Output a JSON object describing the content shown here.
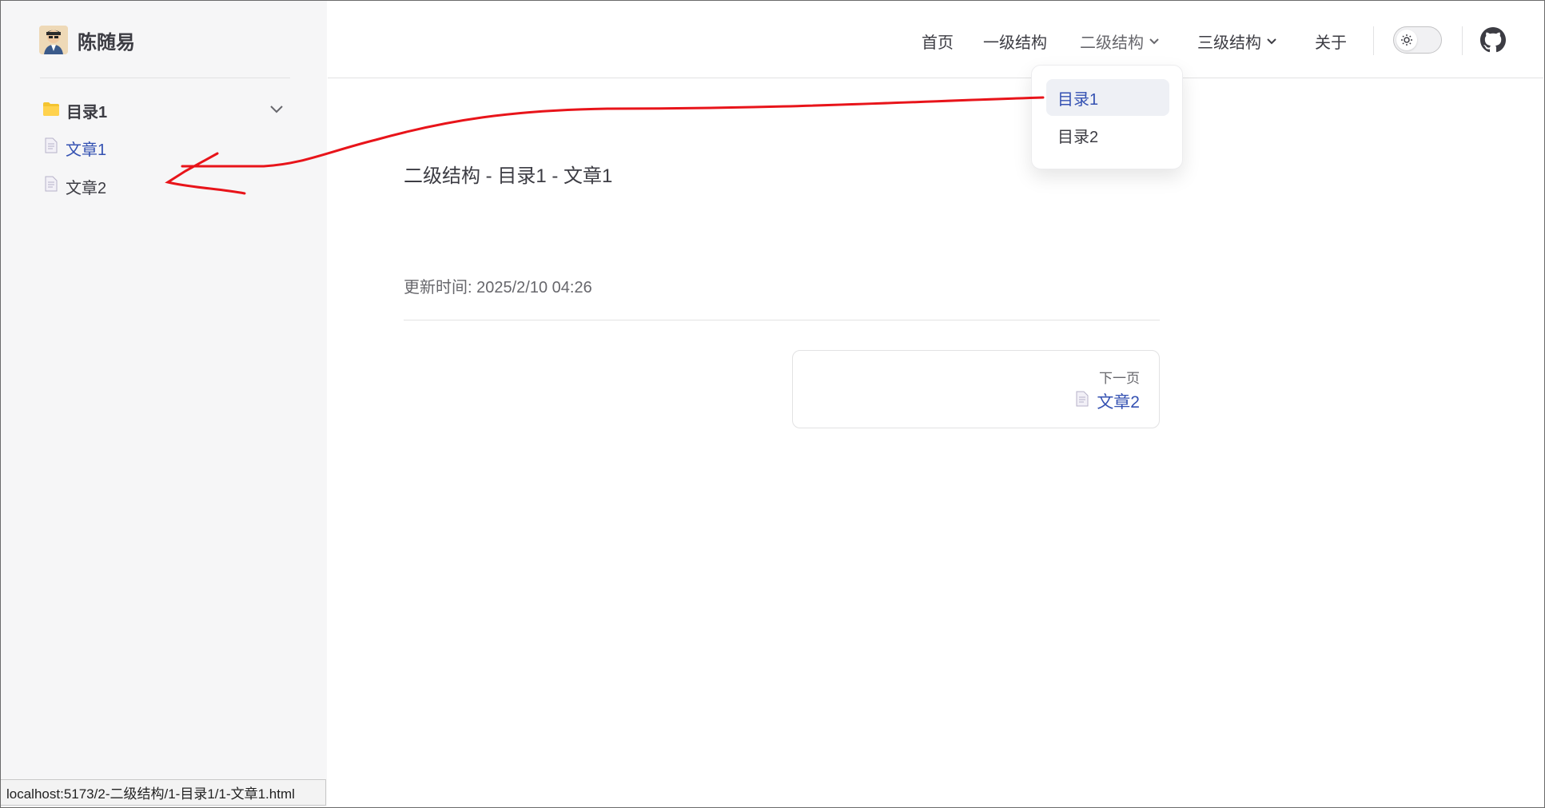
{
  "brand": {
    "name": "陈随易"
  },
  "sidebar": {
    "section": {
      "label": "目录1",
      "icon": "folder-icon"
    },
    "items": [
      {
        "label": "文章1",
        "active": true,
        "icon": "document-icon"
      },
      {
        "label": "文章2",
        "active": false,
        "icon": "document-icon"
      }
    ]
  },
  "nav": {
    "items": [
      {
        "label": "首页"
      },
      {
        "label": "一级结构"
      },
      {
        "label": "二级结构",
        "dropdown": true
      },
      {
        "label": "三级结构",
        "dropdown": true
      },
      {
        "label": "关于"
      }
    ],
    "theme_toggle": "sun-icon",
    "github": "github-icon"
  },
  "dropdown": {
    "items": [
      {
        "label": "目录1",
        "active": true
      },
      {
        "label": "目录2",
        "active": false
      }
    ]
  },
  "main": {
    "title": "二级结构 - 目录1 - 文章1",
    "updated": "更新时间: 2025/2/10 04:26",
    "next": {
      "caption": "下一页",
      "label": "文章2"
    }
  },
  "statusbar": {
    "url": "localhost:5173/2-二级结构/1-目录1/1-文章1.html"
  },
  "colors": {
    "accent": "#3451b2",
    "annotation": "#e8141a",
    "folder": "#f4c430"
  }
}
